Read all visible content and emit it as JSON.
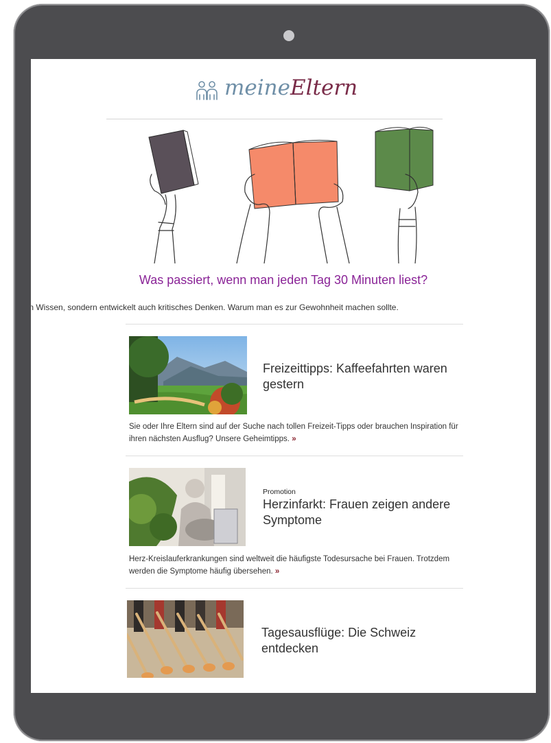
{
  "brand": {
    "logo_light": "meine",
    "logo_dark": "Eltern"
  },
  "headline": {
    "title": "Was passiert, wenn man jeden Tag 30 Minuten liest?",
    "teaser": "ein Wissen, sondern entwickelt auch kritisches Denken. Warum man es zur Gewohnheit machen sollte."
  },
  "articles": [
    {
      "title": "Freizeittipps: Kaffeefahrten waren gestern",
      "description": "Sie oder Ihre Eltern sind auf der Suche nach tollen Freizeit-Tipps oder brauchen Inspiration für ihren nächsten Ausflug? Unsere Geheimtipps.",
      "more": "»"
    },
    {
      "badge": "Promotion",
      "title": "Herzinfarkt: Frauen zeigen andere Symptome",
      "description": "Herz-Kreislauferkrankungen sind weltweit die häufigste Todesursache bei Frauen. Trotzdem werden die Symptome häufig übersehen.",
      "more": "»"
    },
    {
      "title": "Tagesausflüge: Die Schweiz entdecken"
    }
  ],
  "colors": {
    "accent": "#8a2497",
    "logo_light": "#6f8fa7",
    "logo_dark": "#7a2c49",
    "device": "#4c4c4f",
    "book_dark": "#5a5059",
    "book_orange": "#f58a6a",
    "book_green": "#5c8a4a"
  }
}
